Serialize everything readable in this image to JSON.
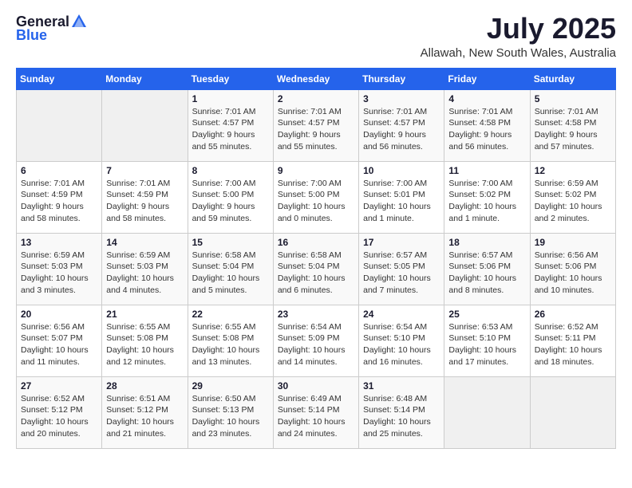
{
  "header": {
    "logo_general": "General",
    "logo_blue": "Blue",
    "month": "July 2025",
    "location": "Allawah, New South Wales, Australia"
  },
  "weekdays": [
    "Sunday",
    "Monday",
    "Tuesday",
    "Wednesday",
    "Thursday",
    "Friday",
    "Saturday"
  ],
  "weeks": [
    [
      {
        "day": "",
        "info": ""
      },
      {
        "day": "",
        "info": ""
      },
      {
        "day": "1",
        "info": "Sunrise: 7:01 AM\nSunset: 4:57 PM\nDaylight: 9 hours\nand 55 minutes."
      },
      {
        "day": "2",
        "info": "Sunrise: 7:01 AM\nSunset: 4:57 PM\nDaylight: 9 hours\nand 55 minutes."
      },
      {
        "day": "3",
        "info": "Sunrise: 7:01 AM\nSunset: 4:57 PM\nDaylight: 9 hours\nand 56 minutes."
      },
      {
        "day": "4",
        "info": "Sunrise: 7:01 AM\nSunset: 4:58 PM\nDaylight: 9 hours\nand 56 minutes."
      },
      {
        "day": "5",
        "info": "Sunrise: 7:01 AM\nSunset: 4:58 PM\nDaylight: 9 hours\nand 57 minutes."
      }
    ],
    [
      {
        "day": "6",
        "info": "Sunrise: 7:01 AM\nSunset: 4:59 PM\nDaylight: 9 hours\nand 58 minutes."
      },
      {
        "day": "7",
        "info": "Sunrise: 7:01 AM\nSunset: 4:59 PM\nDaylight: 9 hours\nand 58 minutes."
      },
      {
        "day": "8",
        "info": "Sunrise: 7:00 AM\nSunset: 5:00 PM\nDaylight: 9 hours\nand 59 minutes."
      },
      {
        "day": "9",
        "info": "Sunrise: 7:00 AM\nSunset: 5:00 PM\nDaylight: 10 hours\nand 0 minutes."
      },
      {
        "day": "10",
        "info": "Sunrise: 7:00 AM\nSunset: 5:01 PM\nDaylight: 10 hours\nand 1 minute."
      },
      {
        "day": "11",
        "info": "Sunrise: 7:00 AM\nSunset: 5:02 PM\nDaylight: 10 hours\nand 1 minute."
      },
      {
        "day": "12",
        "info": "Sunrise: 6:59 AM\nSunset: 5:02 PM\nDaylight: 10 hours\nand 2 minutes."
      }
    ],
    [
      {
        "day": "13",
        "info": "Sunrise: 6:59 AM\nSunset: 5:03 PM\nDaylight: 10 hours\nand 3 minutes."
      },
      {
        "day": "14",
        "info": "Sunrise: 6:59 AM\nSunset: 5:03 PM\nDaylight: 10 hours\nand 4 minutes."
      },
      {
        "day": "15",
        "info": "Sunrise: 6:58 AM\nSunset: 5:04 PM\nDaylight: 10 hours\nand 5 minutes."
      },
      {
        "day": "16",
        "info": "Sunrise: 6:58 AM\nSunset: 5:04 PM\nDaylight: 10 hours\nand 6 minutes."
      },
      {
        "day": "17",
        "info": "Sunrise: 6:57 AM\nSunset: 5:05 PM\nDaylight: 10 hours\nand 7 minutes."
      },
      {
        "day": "18",
        "info": "Sunrise: 6:57 AM\nSunset: 5:06 PM\nDaylight: 10 hours\nand 8 minutes."
      },
      {
        "day": "19",
        "info": "Sunrise: 6:56 AM\nSunset: 5:06 PM\nDaylight: 10 hours\nand 10 minutes."
      }
    ],
    [
      {
        "day": "20",
        "info": "Sunrise: 6:56 AM\nSunset: 5:07 PM\nDaylight: 10 hours\nand 11 minutes."
      },
      {
        "day": "21",
        "info": "Sunrise: 6:55 AM\nSunset: 5:08 PM\nDaylight: 10 hours\nand 12 minutes."
      },
      {
        "day": "22",
        "info": "Sunrise: 6:55 AM\nSunset: 5:08 PM\nDaylight: 10 hours\nand 13 minutes."
      },
      {
        "day": "23",
        "info": "Sunrise: 6:54 AM\nSunset: 5:09 PM\nDaylight: 10 hours\nand 14 minutes."
      },
      {
        "day": "24",
        "info": "Sunrise: 6:54 AM\nSunset: 5:10 PM\nDaylight: 10 hours\nand 16 minutes."
      },
      {
        "day": "25",
        "info": "Sunrise: 6:53 AM\nSunset: 5:10 PM\nDaylight: 10 hours\nand 17 minutes."
      },
      {
        "day": "26",
        "info": "Sunrise: 6:52 AM\nSunset: 5:11 PM\nDaylight: 10 hours\nand 18 minutes."
      }
    ],
    [
      {
        "day": "27",
        "info": "Sunrise: 6:52 AM\nSunset: 5:12 PM\nDaylight: 10 hours\nand 20 minutes."
      },
      {
        "day": "28",
        "info": "Sunrise: 6:51 AM\nSunset: 5:12 PM\nDaylight: 10 hours\nand 21 minutes."
      },
      {
        "day": "29",
        "info": "Sunrise: 6:50 AM\nSunset: 5:13 PM\nDaylight: 10 hours\nand 23 minutes."
      },
      {
        "day": "30",
        "info": "Sunrise: 6:49 AM\nSunset: 5:14 PM\nDaylight: 10 hours\nand 24 minutes."
      },
      {
        "day": "31",
        "info": "Sunrise: 6:48 AM\nSunset: 5:14 PM\nDaylight: 10 hours\nand 25 minutes."
      },
      {
        "day": "",
        "info": ""
      },
      {
        "day": "",
        "info": ""
      }
    ]
  ]
}
